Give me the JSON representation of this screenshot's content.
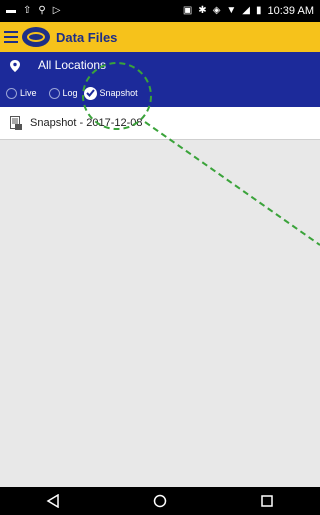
{
  "status_bar": {
    "time": "10:39 AM"
  },
  "app_bar": {
    "title": "Data Files",
    "menu_icon": "hamburger-icon",
    "logo_icon": "app-logo-icon"
  },
  "location": {
    "label": "All Locations",
    "icon": "location-pin-icon"
  },
  "filters": [
    {
      "label": "Live",
      "selected": false
    },
    {
      "label": "Log",
      "selected": false
    },
    {
      "label": "Snapshot",
      "selected": true
    }
  ],
  "files": [
    {
      "label": "Snapshot - 2017-12-08",
      "icon": "file-icon"
    }
  ],
  "nav": {
    "back_icon": "back-icon",
    "home_icon": "home-icon",
    "recents_icon": "recents-icon"
  },
  "colors": {
    "app_bar": "#f6c21b",
    "header": "#1c2a9a",
    "annotation": "#3aa33a"
  }
}
